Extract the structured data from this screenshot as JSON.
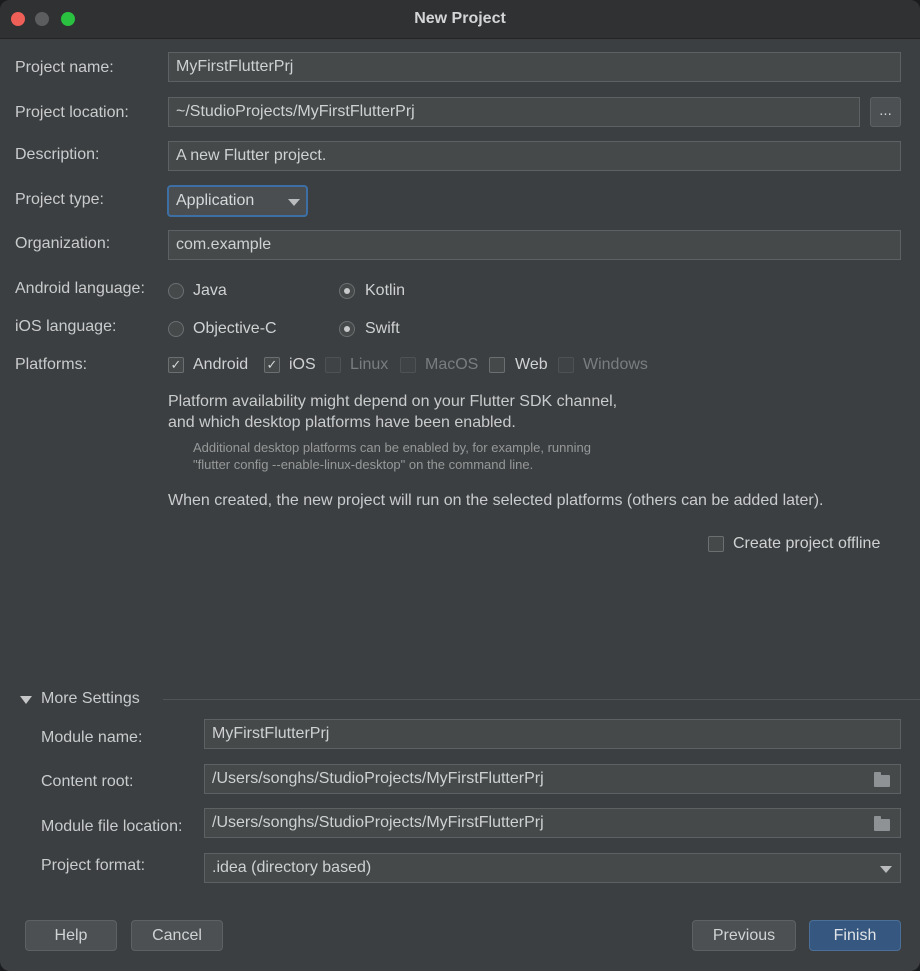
{
  "window": {
    "title": "New Project"
  },
  "form": {
    "project_name": {
      "label": "Project name:",
      "value": "MyFirstFlutterPrj"
    },
    "project_location": {
      "label": "Project location:",
      "value": "~/StudioProjects/MyFirstFlutterPrj",
      "browse_label": "..."
    },
    "description": {
      "label": "Description:",
      "value": "A new Flutter project."
    },
    "project_type": {
      "label": "Project type:",
      "value": "Application"
    },
    "organization": {
      "label": "Organization:",
      "value": "com.example"
    },
    "android_language": {
      "label": "Android language:",
      "options": [
        "Java",
        "Kotlin"
      ],
      "selected": "Kotlin"
    },
    "ios_language": {
      "label": "iOS language:",
      "options": [
        "Objective-C",
        "Swift"
      ],
      "selected": "Swift"
    },
    "platforms": {
      "label": "Platforms:",
      "items": [
        {
          "label": "Android",
          "checked": true,
          "enabled": true
        },
        {
          "label": "iOS",
          "checked": true,
          "enabled": true
        },
        {
          "label": "Linux",
          "checked": false,
          "enabled": false
        },
        {
          "label": "MacOS",
          "checked": false,
          "enabled": false
        },
        {
          "label": "Web",
          "checked": false,
          "enabled": true
        },
        {
          "label": "Windows",
          "checked": false,
          "enabled": false
        }
      ]
    },
    "platform_info_1": "Platform availability might depend on your Flutter SDK channel,",
    "platform_info_2": "and which desktop platforms have been enabled.",
    "platform_note_1": "Additional desktop platforms can be enabled by, for example, running",
    "platform_note_2": "\"flutter config --enable-linux-desktop\" on the command line.",
    "platform_info_3": "When created, the new project will run on the selected platforms (others can be added later).",
    "offline": {
      "label": "Create project offline",
      "checked": false
    }
  },
  "more_settings": {
    "title": "More Settings",
    "expanded": true,
    "module_name": {
      "label": "Module name:",
      "value": "MyFirstFlutterPrj"
    },
    "content_root": {
      "label": "Content root:",
      "value": "/Users/songhs/StudioProjects/MyFirstFlutterPrj"
    },
    "module_file_location": {
      "label": "Module file location:",
      "value": "/Users/songhs/StudioProjects/MyFirstFlutterPrj"
    },
    "project_format": {
      "label": "Project format:",
      "value": ".idea (directory based)"
    }
  },
  "buttons": {
    "help": "Help",
    "cancel": "Cancel",
    "previous": "Previous",
    "finish": "Finish"
  },
  "colors": {
    "background": "#3c3f41",
    "field": "#45494a",
    "primary_button": "#365880",
    "focus_border": "#3d6fa5"
  }
}
